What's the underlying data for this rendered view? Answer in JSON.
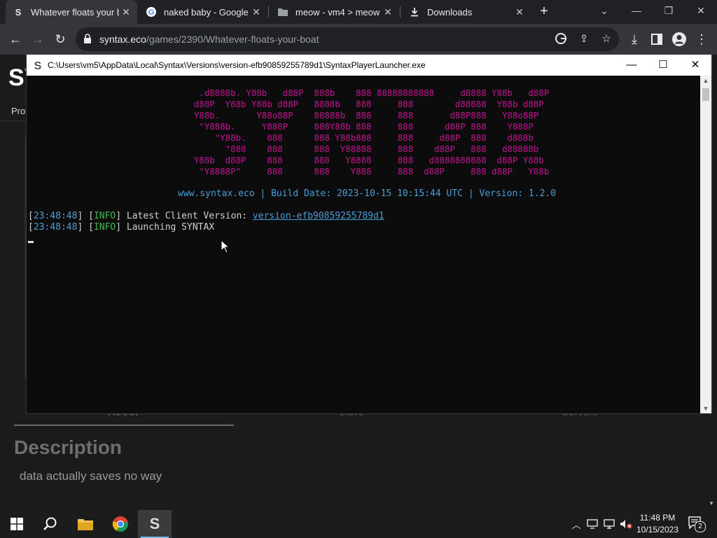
{
  "browser": {
    "tabs": [
      {
        "title": "Whatever floats your boat",
        "icon": "syntax-favicon"
      },
      {
        "title": "naked baby - Google Search",
        "icon": "google-favicon"
      },
      {
        "title": "meow - vm4 > meow",
        "icon": "folder-icon"
      },
      {
        "title": "Downloads",
        "icon": "download-icon"
      }
    ],
    "url_host": "syntax.eco",
    "url_path": "/games/2390/Whatever-floats-your-boat"
  },
  "page": {
    "brand": "SY",
    "nav_text": "Prof",
    "tabs": [
      "About",
      "Store",
      "Servers"
    ],
    "description_heading": "Description",
    "description_text": "data actually saves no way"
  },
  "console": {
    "title": "C:\\Users\\vm5\\AppData\\Local\\Syntax\\Versions\\version-efb90859255789d1\\SyntaxPlayerLauncher.exe",
    "ascii_art": "   .d8888b. Y88b   d88P  888b    888 88888888888     d8888 Y88b   d88P\n  d88P  Y88b Y88b d88P   8888b   888     888        d88888  Y88b d88P\n  Y88b.       Y88o88P    88888b  888     888       d88P888   Y88o88P\n   \"Y888b.     Y888P     888Y88b 888     888      d88P 888    Y888P\n      \"Y88b.    888      888 Y88b888     888     d88P  888    d888b\n        \"888    888      888  Y88888     888    d88P   888   d88888b\n  Y88b  d88P    888      888   Y8888     888   d8888888888  d88P Y88b\n   \"Y8888P\"     888      888    Y888     888  d88P     888 d88P   Y88b",
    "banner_site": "www.syntax.eco",
    "banner_build": "Build Date: 2023-10-15 10:15:44 UTC",
    "banner_version": "Version: 1.2.0",
    "logs": [
      {
        "time": "23:48:48",
        "level": "INFO",
        "message": "Latest Client Version: ",
        "link": "version-efb90859255789d1"
      },
      {
        "time": "23:48:48",
        "level": "INFO",
        "message": "Launching SYNTAX",
        "link": ""
      }
    ]
  },
  "taskbar": {
    "time": "11:48 PM",
    "date": "10/15/2023",
    "notification_count": "2",
    "apps": [
      "start-button",
      "search-button",
      "file-explorer",
      "chrome",
      "syntax-launcher"
    ]
  },
  "colors": {
    "ascii": "#c0178f",
    "banner": "#4a9ed8",
    "info": "#3fb950",
    "console_bg": "#0c0c0c",
    "browser_chrome": "#35363a"
  }
}
